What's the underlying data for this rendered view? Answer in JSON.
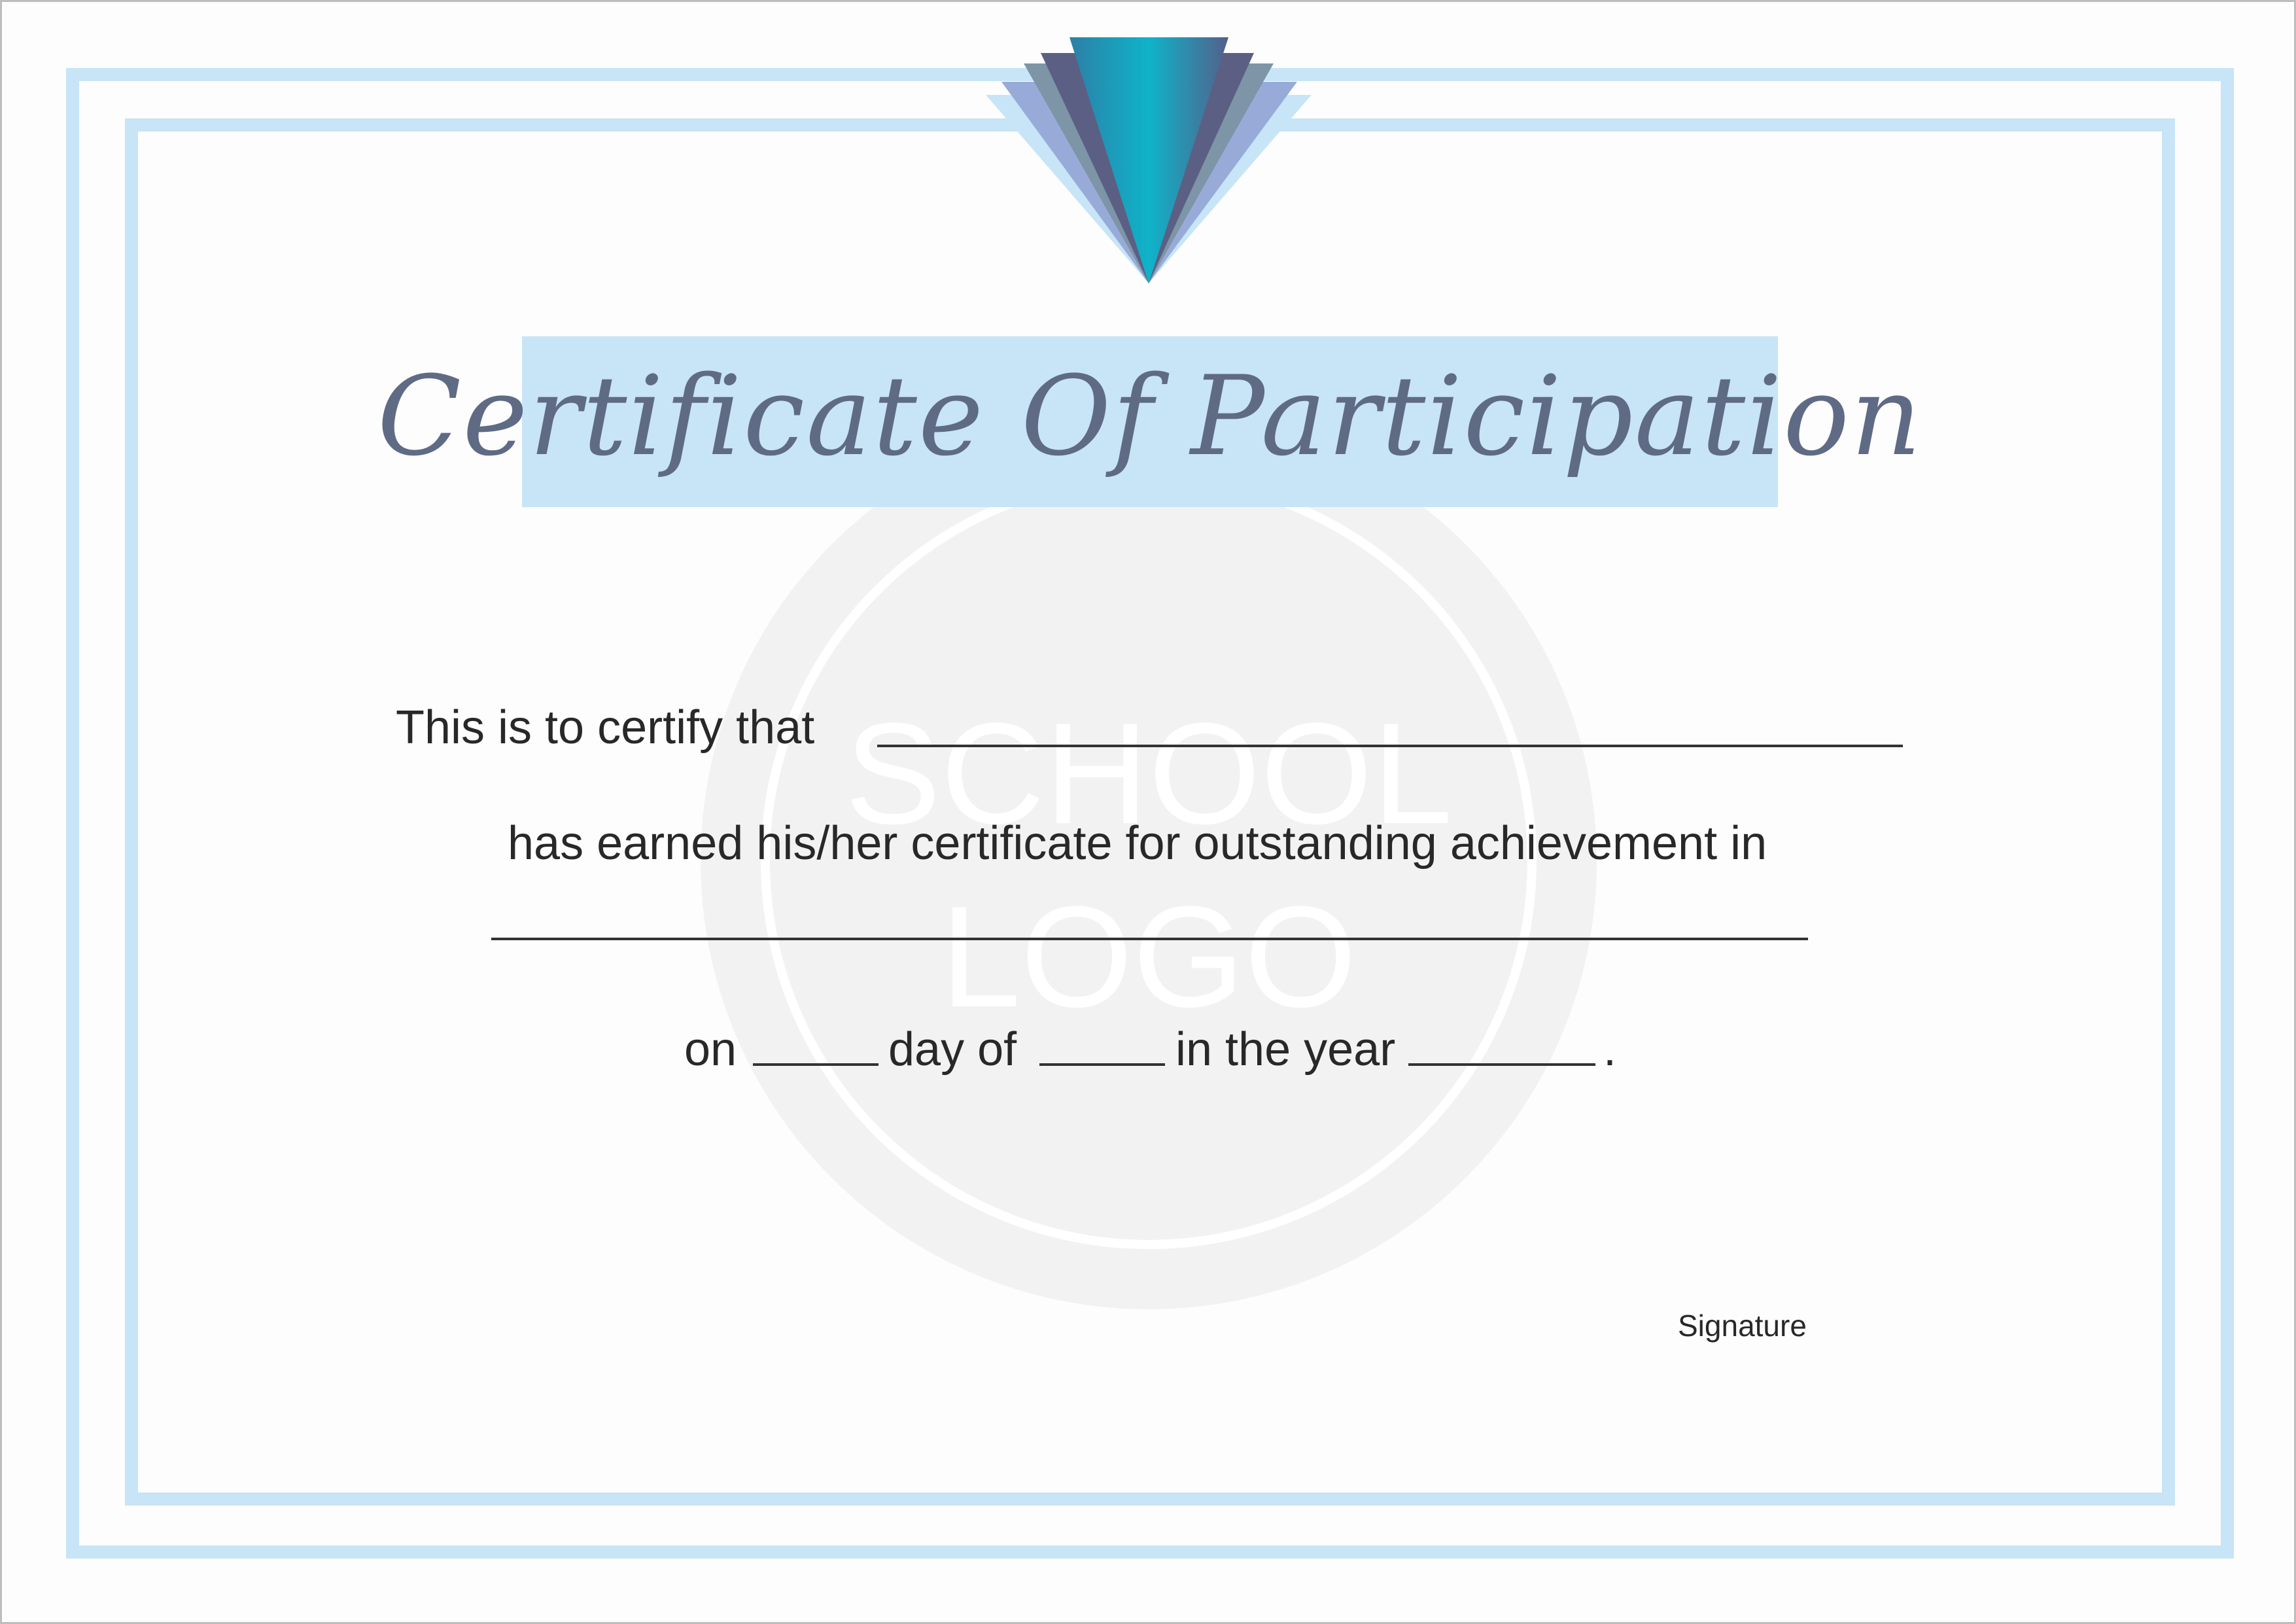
{
  "certificate": {
    "title": "Certificate Of Participation",
    "certify_text": "This is to certify that",
    "earned_text": "has earned his/her certificate for outstanding achievement in",
    "date_line": {
      "on": "on",
      "day_of": "day of",
      "in_the_year": "in the year",
      "period": "."
    },
    "signature_label": "Signature"
  },
  "watermark": {
    "line1": "SCHOOL",
    "line2": "LOGO"
  },
  "colors": {
    "border": "#c7e5f6",
    "title_band": "#c7e5f6",
    "title_text": "#5f6b85",
    "body_text": "#282828",
    "emblem_teal": "#0fb3c9",
    "emblem_slate": "#5b5f84",
    "emblem_gray": "#7d95a6",
    "emblem_periwinkle": "#98abd8",
    "emblem_light": "#c7e5f6"
  }
}
